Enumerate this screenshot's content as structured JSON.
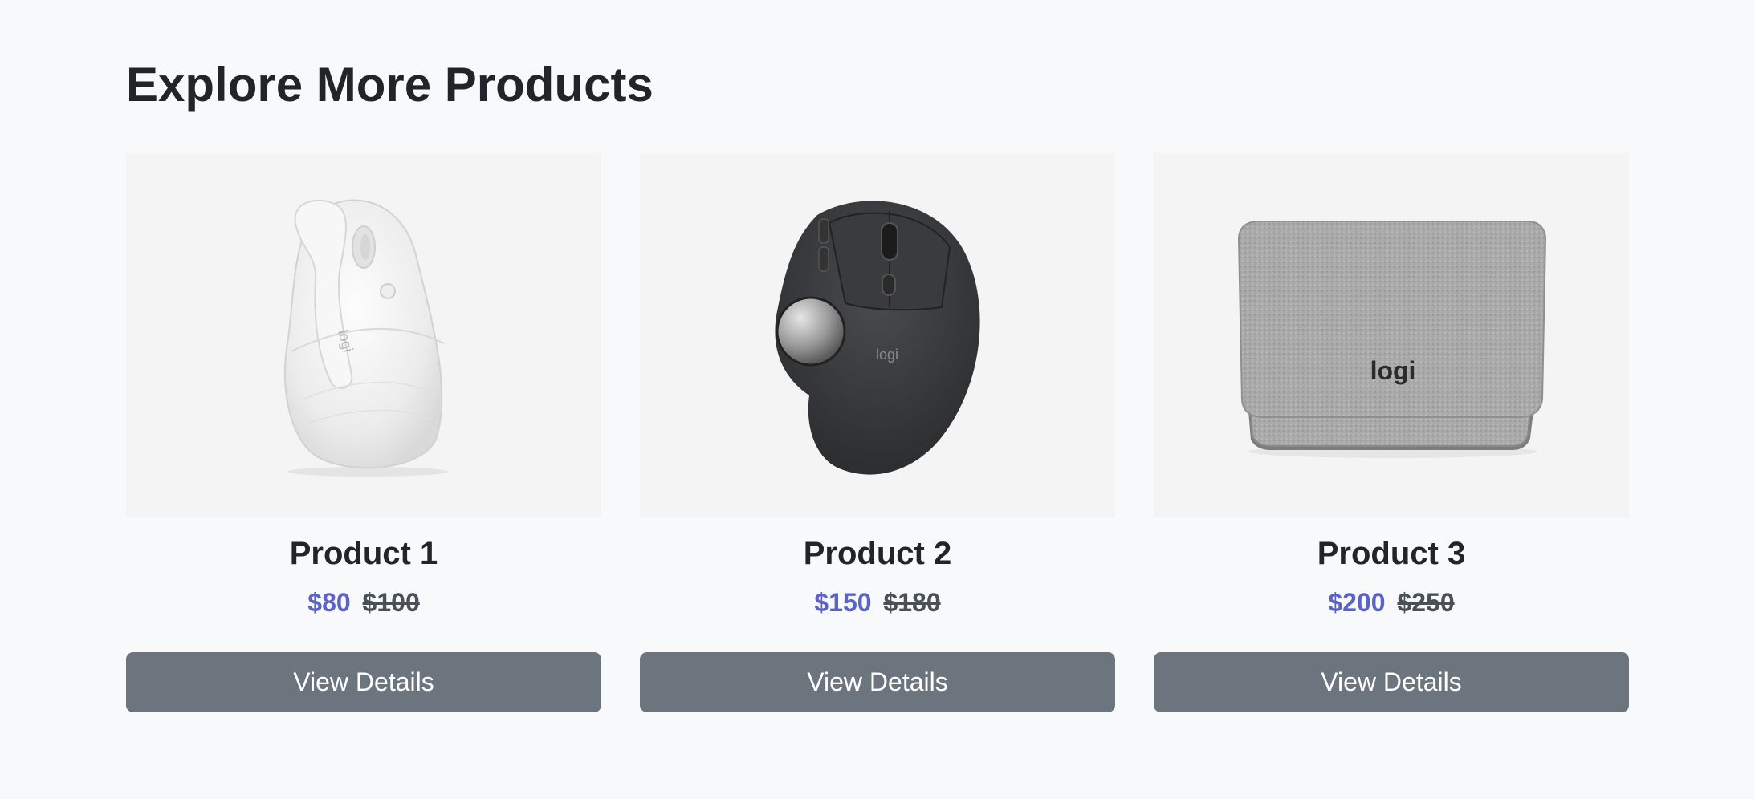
{
  "section": {
    "title": "Explore More Products"
  },
  "products": [
    {
      "name": "Product 1",
      "price": "$80",
      "original_price": "$100",
      "button_label": "View Details",
      "image": "white-vertical-mouse-image",
      "image_text": "logi"
    },
    {
      "name": "Product 2",
      "price": "$150",
      "original_price": "$180",
      "button_label": "View Details",
      "image": "black-trackball-mouse-image",
      "image_text": "logi"
    },
    {
      "name": "Product 3",
      "price": "$200",
      "original_price": "$250",
      "button_label": "View Details",
      "image": "grey-felt-pouch-image",
      "image_text": "logi"
    }
  ],
  "colors": {
    "page_background": "#f8f9fa",
    "image_background": "#f4f4f4",
    "sale_price": "#5b63c6",
    "original_price": "#495057",
    "button_background": "#6c757d",
    "button_text": "#ffffff",
    "title_text": "#212529"
  }
}
